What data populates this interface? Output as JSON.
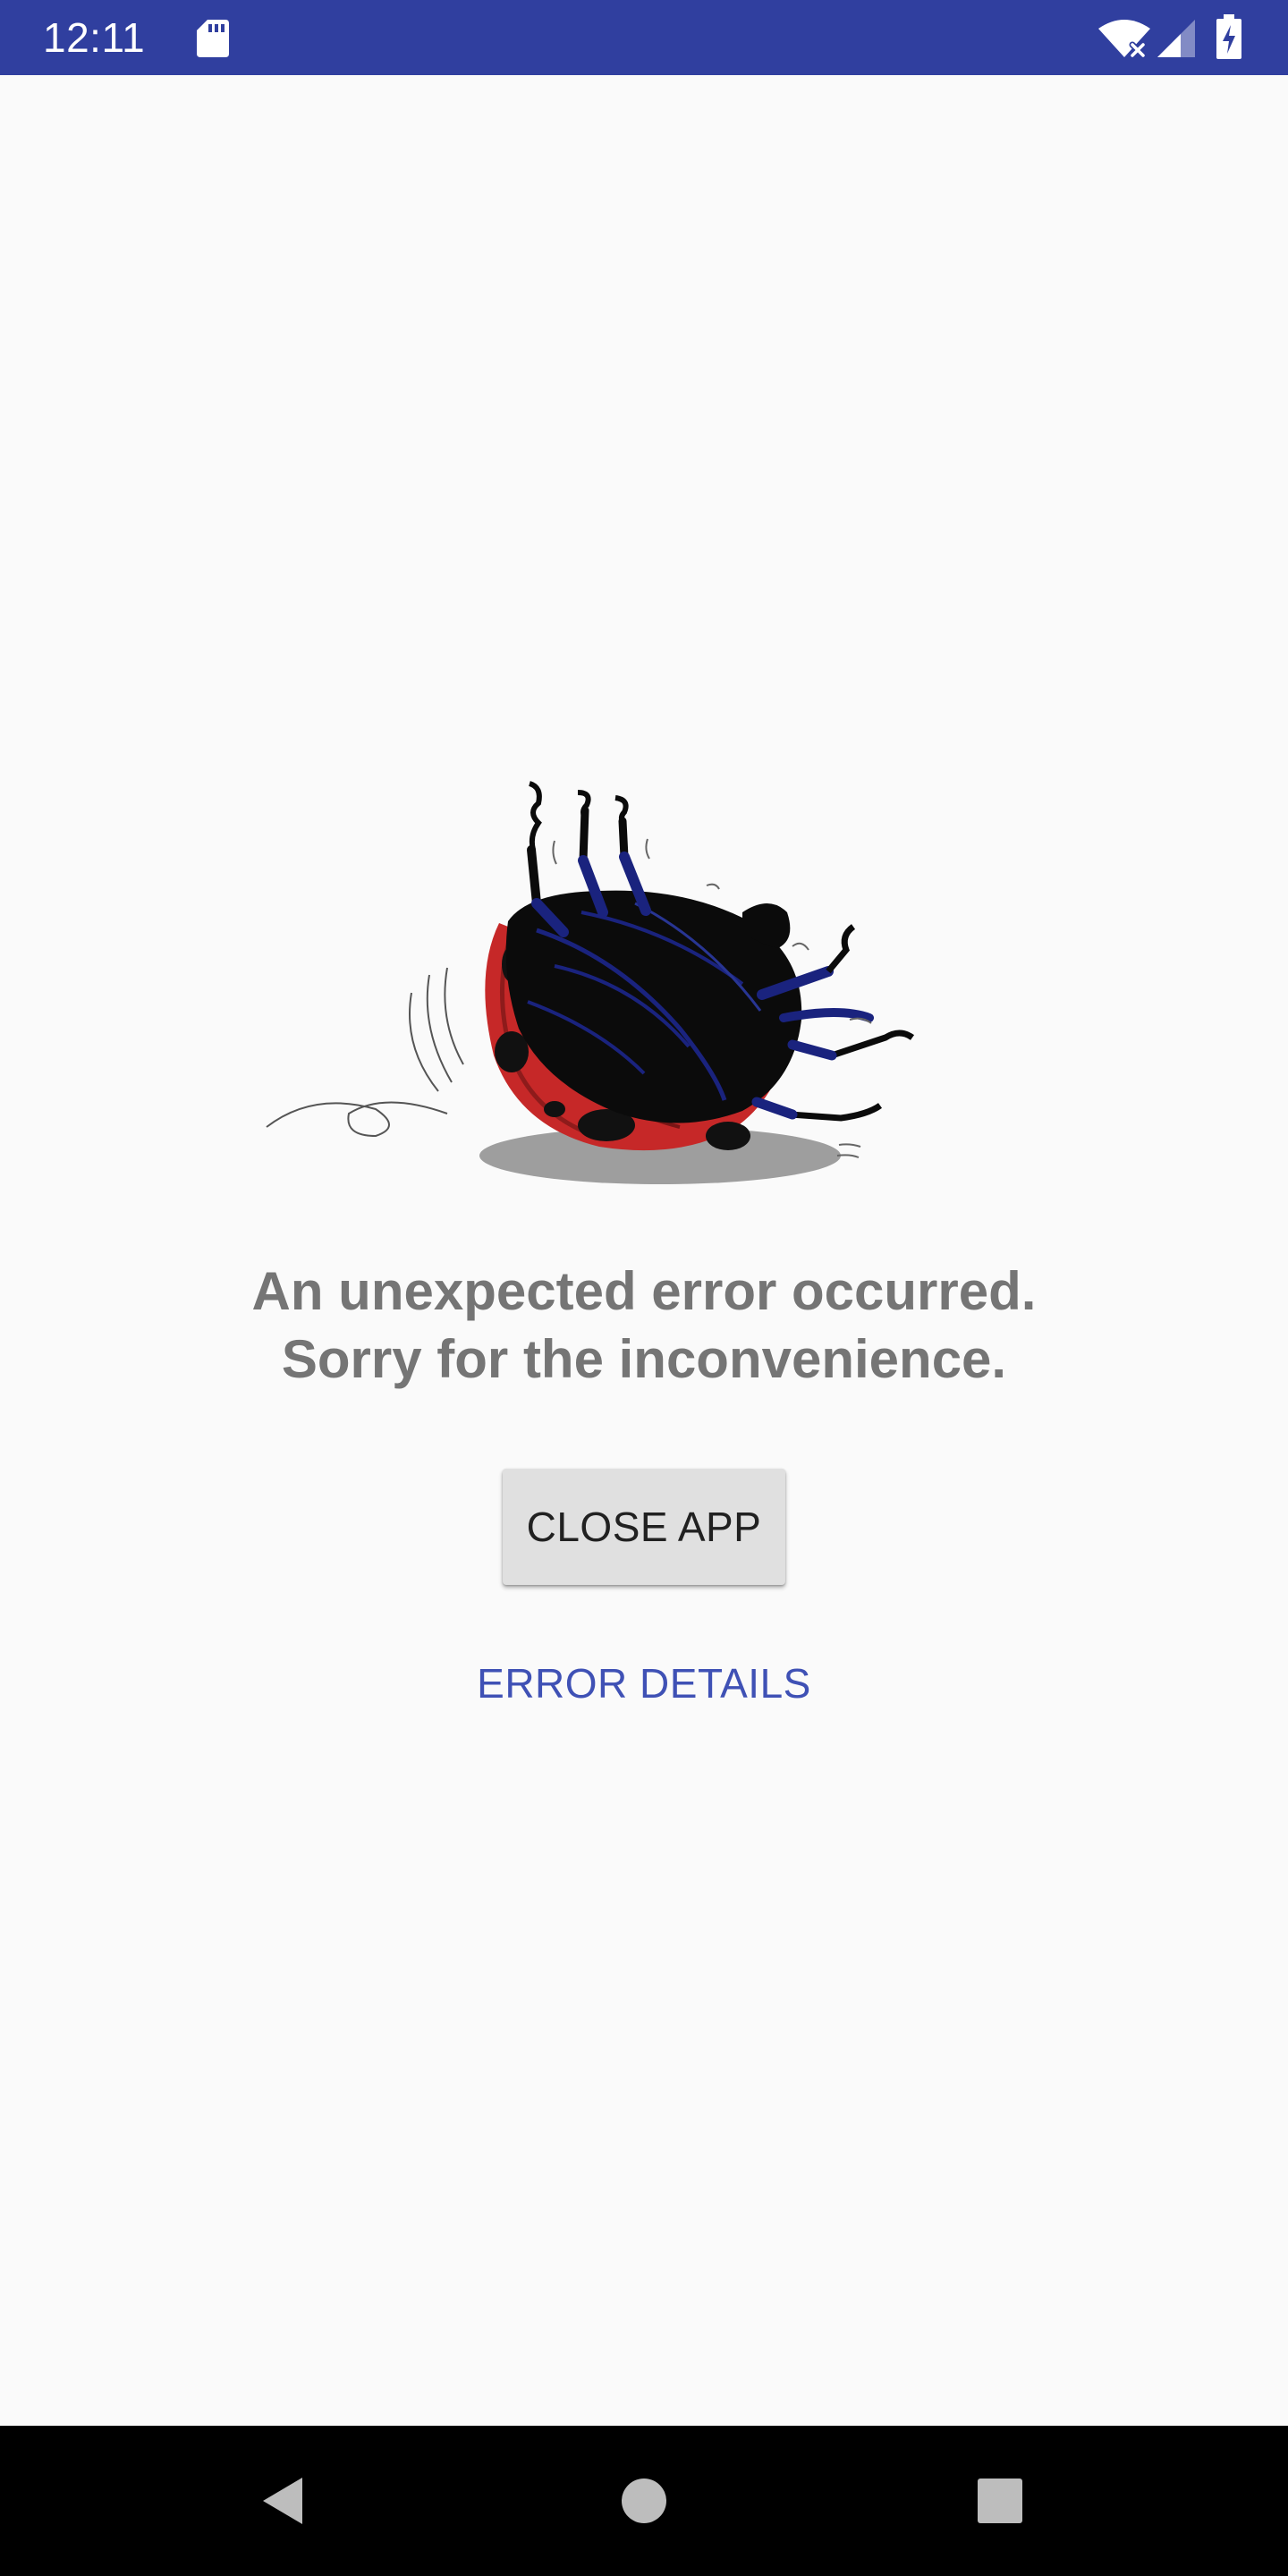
{
  "status_bar": {
    "time": "12:11",
    "background_color": "#303f9f",
    "icons": [
      "sd-card-icon",
      "wifi-icon",
      "cell-signal-icon",
      "battery-charging-icon"
    ]
  },
  "illustration": {
    "icon": "upside-down-ladybug-icon"
  },
  "message": {
    "line1": "An unexpected error occurred.",
    "line2": "Sorry for the inconvenience."
  },
  "actions": {
    "close_label": "CLOSE APP",
    "details_label": "ERROR DETAILS",
    "accent_color": "#3f51b5"
  },
  "nav_bar": {
    "icons": [
      "back-icon",
      "home-icon",
      "recents-icon"
    ]
  }
}
